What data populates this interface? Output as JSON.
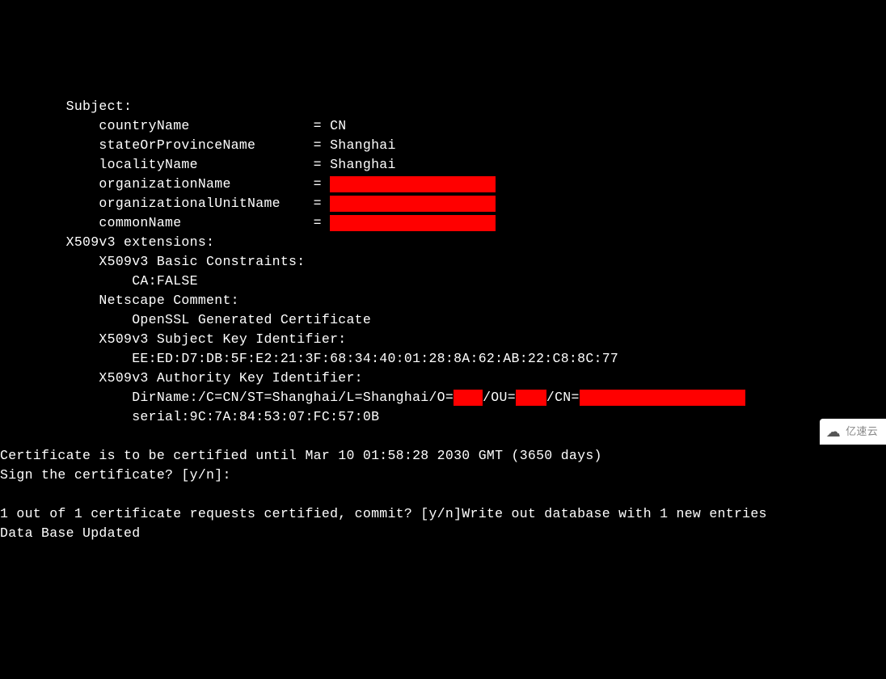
{
  "lines": {
    "subject_label": "        Subject:",
    "country_line": "            countryName               = CN",
    "state_line": "            stateOrProvinceName       = Shanghai",
    "locality_line": "            localityName              = Shanghai",
    "org_line_prefix": "            organizationName          = ",
    "orgunit_line_prefix": "            organizationalUnitName    = ",
    "common_line_prefix": "            commonName                = ",
    "ext_label": "        X509v3 extensions:",
    "basic_constraints_label": "            X509v3 Basic Constraints:",
    "ca_false": "                CA:FALSE",
    "netscape_label": "            Netscape Comment:",
    "openssl_generated": "                OpenSSL Generated Certificate",
    "subject_key_label": "            X509v3 Subject Key Identifier:",
    "subject_key_value": "                EE:ED:D7:DB:5F:E2:21:3F:68:34:40:01:28:8A:62:AB:22:C8:8C:77",
    "authority_key_label": "            X509v3 Authority Key Identifier:",
    "dirname_prefix": "                DirName:/C=CN/ST=Shanghai/L=Shanghai/O=",
    "dirname_ou": "/OU=",
    "dirname_cn": "/CN=",
    "serial_line": "                serial:9C:7A:84:53:07:FC:57:0B",
    "blank": "",
    "cert_until": "Certificate is to be certified until Mar 10 01:58:28 2030 GMT (3650 days)",
    "sign_prompt": "Sign the certificate? [y/n]:",
    "commit_line": "1 out of 1 certificate requests certified, commit? [y/n]Write out database with 1 new entries",
    "db_updated": "Data Base Updated"
  },
  "watermark": {
    "label": "亿速云"
  }
}
